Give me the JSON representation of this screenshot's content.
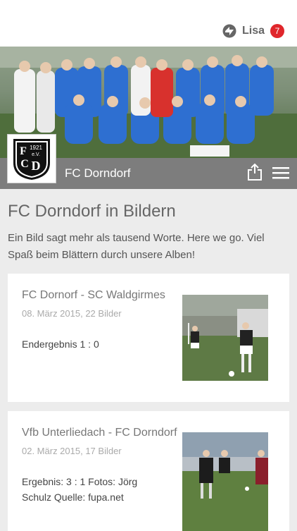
{
  "header": {
    "user_name": "Lisa",
    "notification_count": "7",
    "badge_color": "#e0262b",
    "user_icon": "sync-icon"
  },
  "club": {
    "name": "FC Dorndorf",
    "logo": {
      "year": "1921",
      "suffix": "e.V.",
      "letters": "FCD"
    },
    "share_icon": "share-icon",
    "menu_icon": "hamburger-menu-icon"
  },
  "page": {
    "title": "FC Dorndorf in Bildern",
    "intro": "Ein Bild sagt mehr als tausend Worte. Here we go. Viel Spaß beim Blättern durch unsere Alben!"
  },
  "albums": [
    {
      "title": "FC Dornorf - SC Waldgirmes",
      "meta": "08. März 2015, 22 Bilder",
      "description": "Endergebnis 1 : 0"
    },
    {
      "title": "Vfb Unterliedach - FC Dorndorf",
      "meta": "02. März 2015, 17 Bilder",
      "description": "Ergebnis: 3 : 1 Fotos: Jörg Schulz Quelle: fupa.net"
    }
  ],
  "colors": {
    "club_bar": "#7d7d7d",
    "background": "#ececec",
    "team_kit": "#2e6fd1"
  }
}
